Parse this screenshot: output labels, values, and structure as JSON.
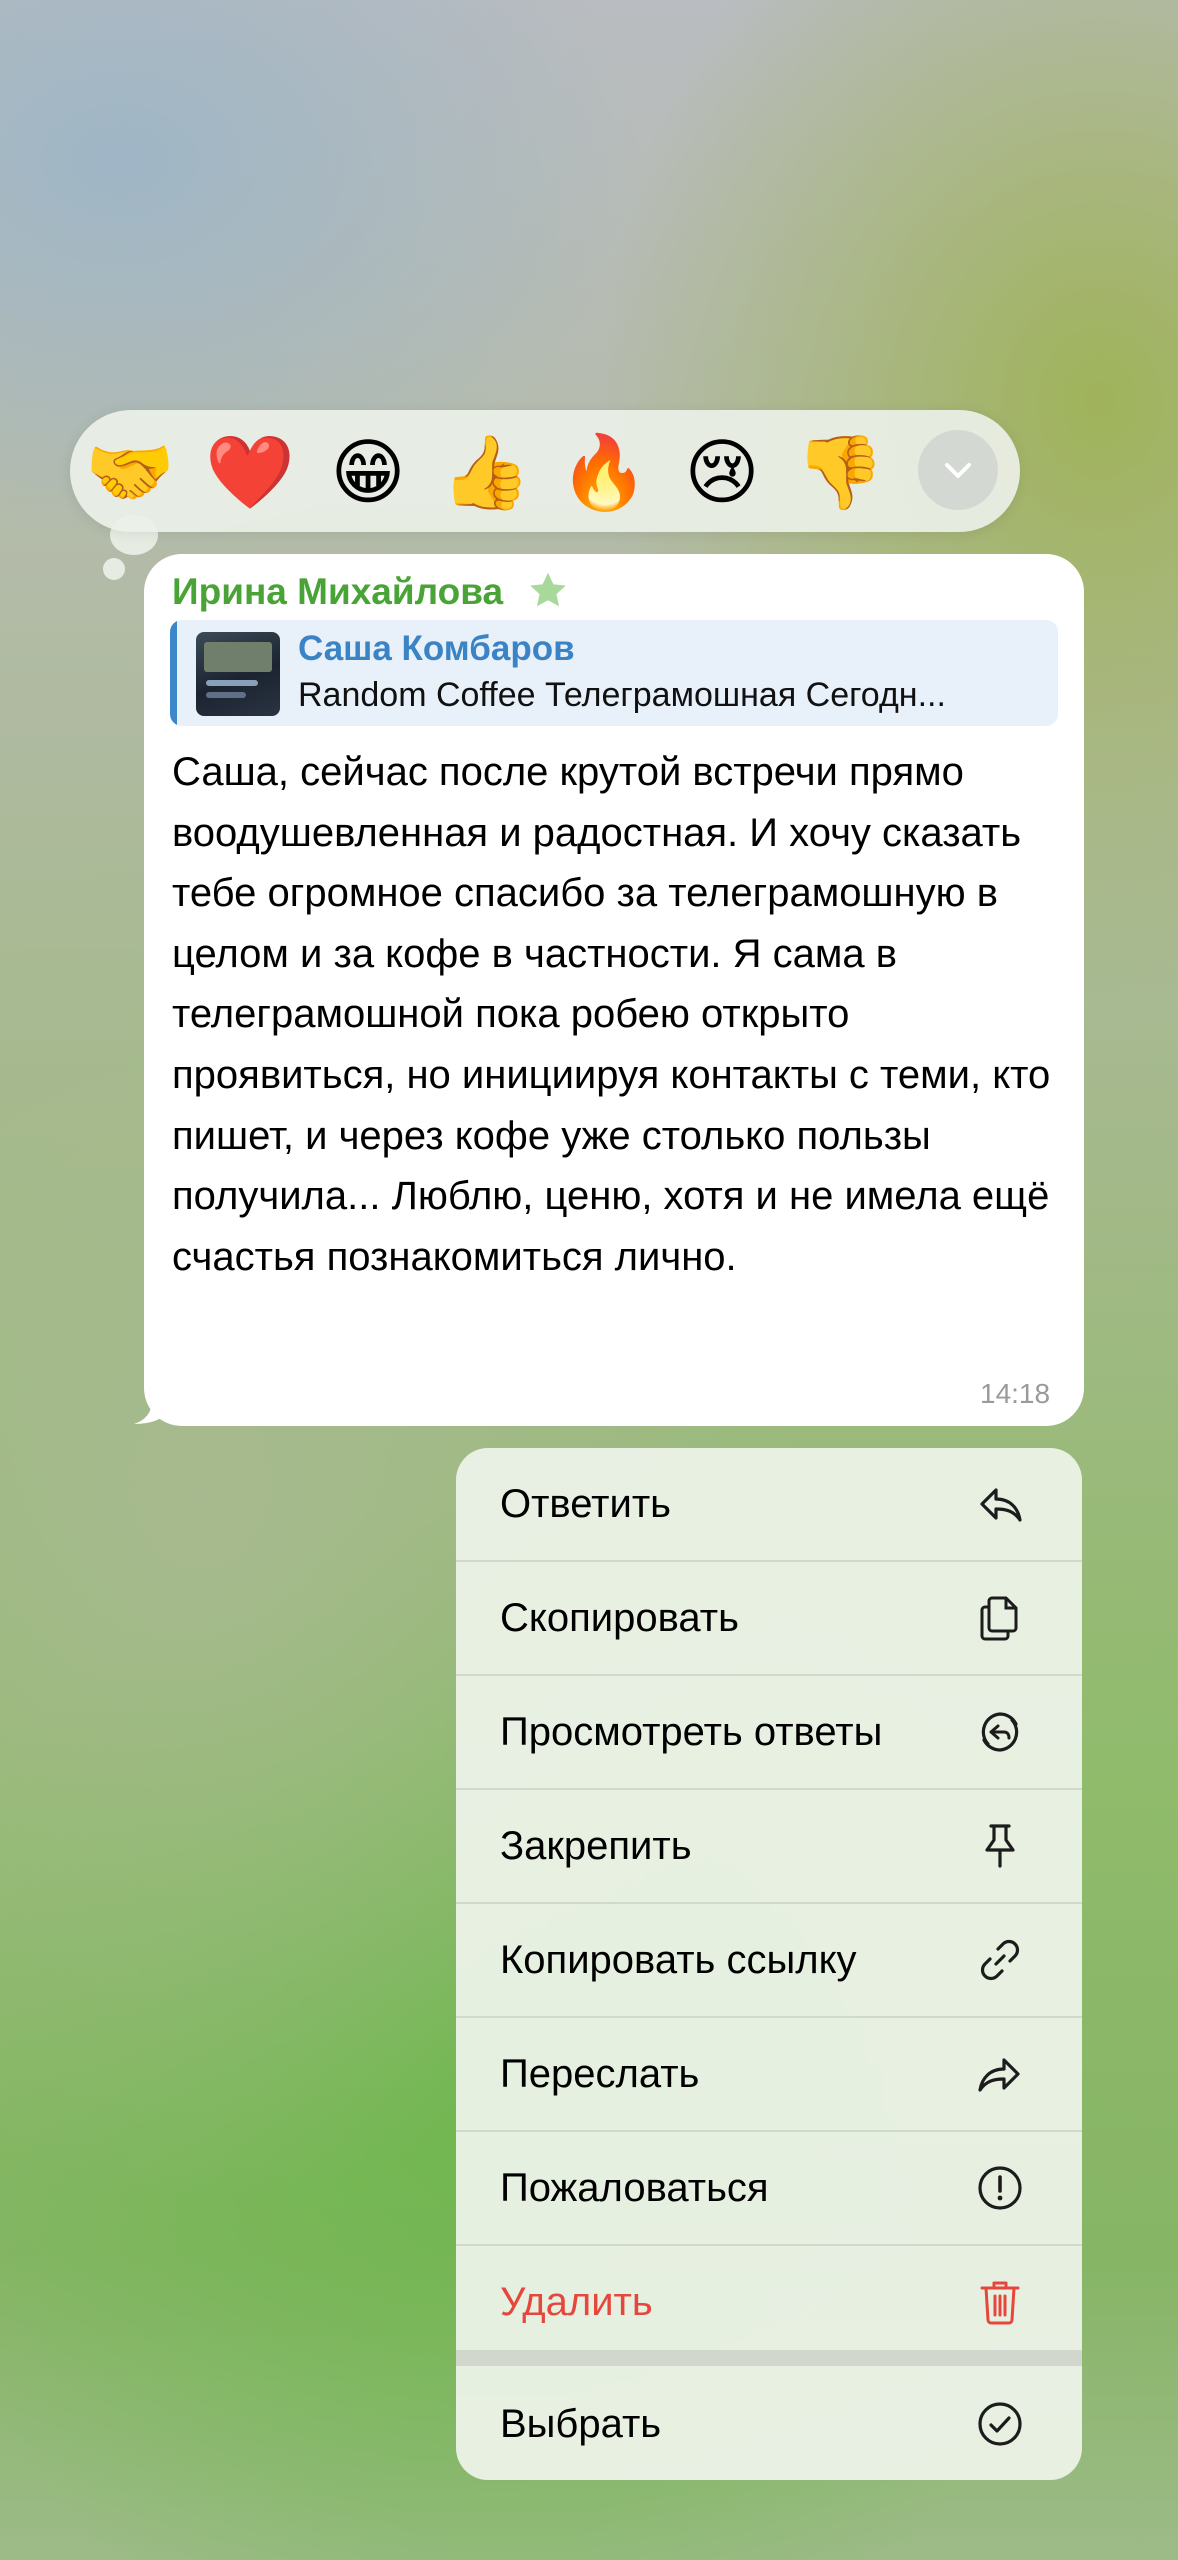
{
  "reactions": [
    {
      "emoji": "🤝",
      "name": "handshake"
    },
    {
      "emoji": "❤️",
      "name": "heart"
    },
    {
      "emoji": "😁",
      "name": "grin"
    },
    {
      "emoji": "👍",
      "name": "thumbs-up"
    },
    {
      "emoji": "🔥",
      "name": "fire"
    },
    {
      "emoji": "😢",
      "name": "crying"
    },
    {
      "emoji": "👎",
      "name": "thumbs-down"
    }
  ],
  "message": {
    "sender": "Ирина Михайлова",
    "reply": {
      "author": "Саша Комбаров",
      "preview": "Random Coffee Телеграмошная Сегодн..."
    },
    "text": "Саша, сейчас после крутой встречи прямо воодушевленная и радостная. И хочу сказать тебе огромное спасибо за телеграмошную в целом и за кофе в частности. Я сама в телеграмошной пока робею открыто проявиться, но инициируя контакты с теми, кто пишет, и через кофе уже столько пользы получила... Люблю, ценю, хотя и не имела ещё счастья познакомиться лично.",
    "time": "14:18"
  },
  "menu": {
    "reply": "Ответить",
    "copy": "Скопировать",
    "view_replies": "Просмотреть ответы",
    "pin": "Закрепить",
    "copy_link": "Копировать ссылку",
    "forward": "Переслать",
    "report": "Пожаловаться",
    "delete": "Удалить",
    "select": "Выбрать"
  },
  "colors": {
    "sender": "#4aa336",
    "reply_author": "#3a83c4",
    "delete": "#e5473c"
  }
}
